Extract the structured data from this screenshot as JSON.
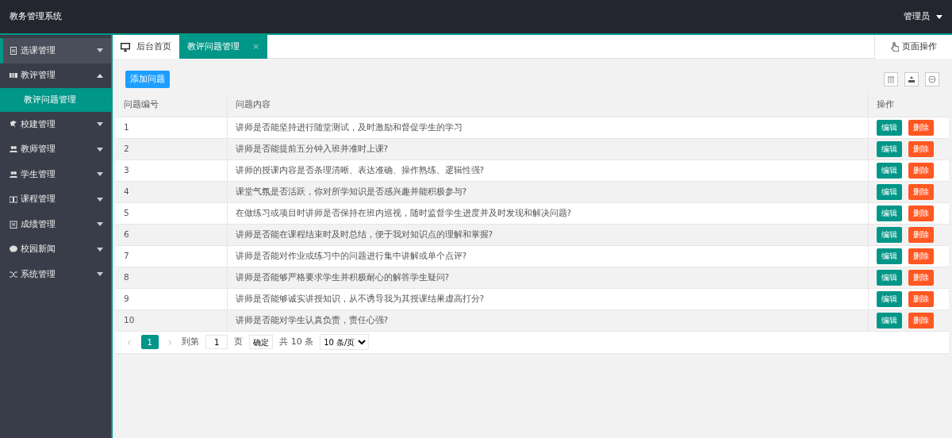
{
  "header": {
    "title": "教务管理系统",
    "user": "管理员"
  },
  "sidebar": {
    "items": [
      {
        "label": "选课管理",
        "highlighted": true,
        "expanded": false
      },
      {
        "label": "教评管理",
        "highlighted": false,
        "expanded": true,
        "children": [
          {
            "label": "教评问题管理",
            "selected": true
          }
        ]
      },
      {
        "label": "校建管理",
        "highlighted": false,
        "expanded": false
      },
      {
        "label": "教师管理",
        "highlighted": false,
        "expanded": false
      },
      {
        "label": "学生管理",
        "highlighted": false,
        "expanded": false
      },
      {
        "label": "课程管理",
        "highlighted": false,
        "expanded": false
      },
      {
        "label": "成绩管理",
        "highlighted": false,
        "expanded": false
      },
      {
        "label": "校园新闻",
        "highlighted": false,
        "expanded": false
      },
      {
        "label": "系统管理",
        "highlighted": false,
        "expanded": false
      }
    ]
  },
  "tabs": [
    {
      "label": "后台首页",
      "selected": false
    },
    {
      "label": "教评问题管理",
      "selected": true,
      "close": "×"
    }
  ],
  "page_actions": "页面操作",
  "toolbar": {
    "add_button": "添加问题"
  },
  "table": {
    "columns": [
      "问题编号",
      "问题内容",
      "操作"
    ],
    "rows": [
      {
        "id": "1",
        "content": "讲师是否能坚持进行随堂测试，及时激励和督促学生的学习",
        "actions": [
          "编辑",
          "删除"
        ]
      },
      {
        "id": "2",
        "content": "讲师是否能提前五分钟入班并准时上课?",
        "actions": [
          "编辑",
          "删除"
        ]
      },
      {
        "id": "3",
        "content": "讲师的授课内容是否条理清晰、表达准确、操作熟练、逻辑性强?",
        "actions": [
          "编辑",
          "删除"
        ]
      },
      {
        "id": "4",
        "content": "课堂气氛是否活跃，你对所学知识是否感兴趣并能积极参与?",
        "actions": [
          "编辑",
          "删除"
        ]
      },
      {
        "id": "5",
        "content": "在做练习或项目时讲师是否保持在班内巡视，随时监督学生进度并及时发现和解决问题?",
        "actions": [
          "编辑",
          "删除"
        ]
      },
      {
        "id": "6",
        "content": "讲师是否能在课程结束时及时总结，便于我对知识点的理解和掌握?",
        "actions": [
          "编辑",
          "删除"
        ]
      },
      {
        "id": "7",
        "content": "讲师是否能对作业或练习中的问题进行集中讲解或单个点评?",
        "actions": [
          "编辑",
          "删除"
        ]
      },
      {
        "id": "8",
        "content": "讲师是否能够严格要求学生并积极耐心的解答学生疑问?",
        "actions": [
          "编辑",
          "删除"
        ]
      },
      {
        "id": "9",
        "content": "讲师是否能够诚实讲授知识，从不诱导我为其授课结果虚高打分?",
        "actions": [
          "编辑",
          "删除"
        ]
      },
      {
        "id": "10",
        "content": "讲师是否能对学生认真负责，责任心强?",
        "actions": [
          "编辑",
          "删除"
        ]
      }
    ]
  },
  "pagination": {
    "prev": "‹",
    "prev_disabled": true,
    "pages": [
      {
        "label": "1",
        "selected": true
      }
    ],
    "next": "›",
    "goto_label": "到第",
    "goto_value": "1",
    "page_unit": "页",
    "confirm": "确定",
    "total": "共 10 条",
    "page_size": "10 条/页"
  }
}
